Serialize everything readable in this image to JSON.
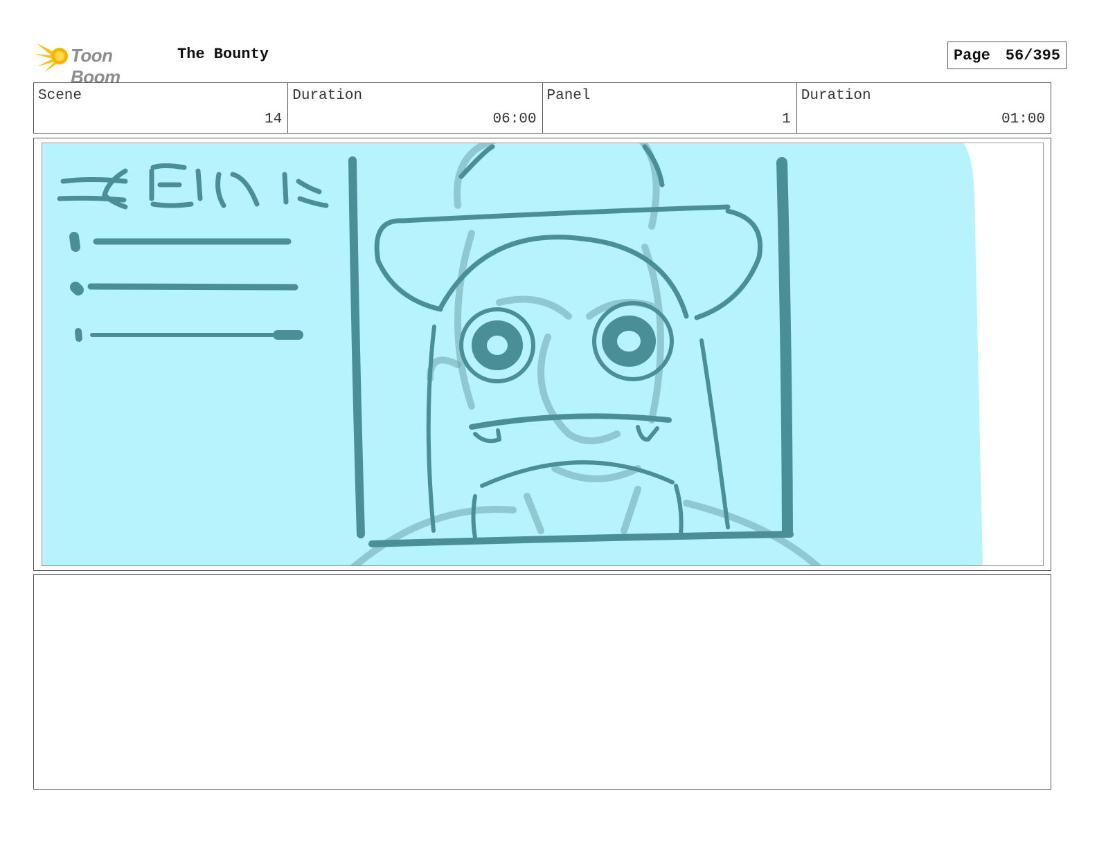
{
  "header": {
    "logo_text": "Toon Boom",
    "title": "The Bounty",
    "page_label": "Page",
    "page_value": "56/395"
  },
  "info": {
    "scene_label": "Scene",
    "scene_value": "14",
    "scene_duration_label": "Duration",
    "scene_duration_value": "06:00",
    "panel_label": "Panel",
    "panel_value": "1",
    "panel_duration_label": "Duration",
    "panel_duration_value": "01:00"
  },
  "colors": {
    "sketch_bg": "#b6f3fc",
    "sketch_line": "#4a8f98",
    "sketch_faint": "#6fa4ab",
    "logo_yellow": "#f5c518"
  },
  "notes": {
    "text": ""
  }
}
